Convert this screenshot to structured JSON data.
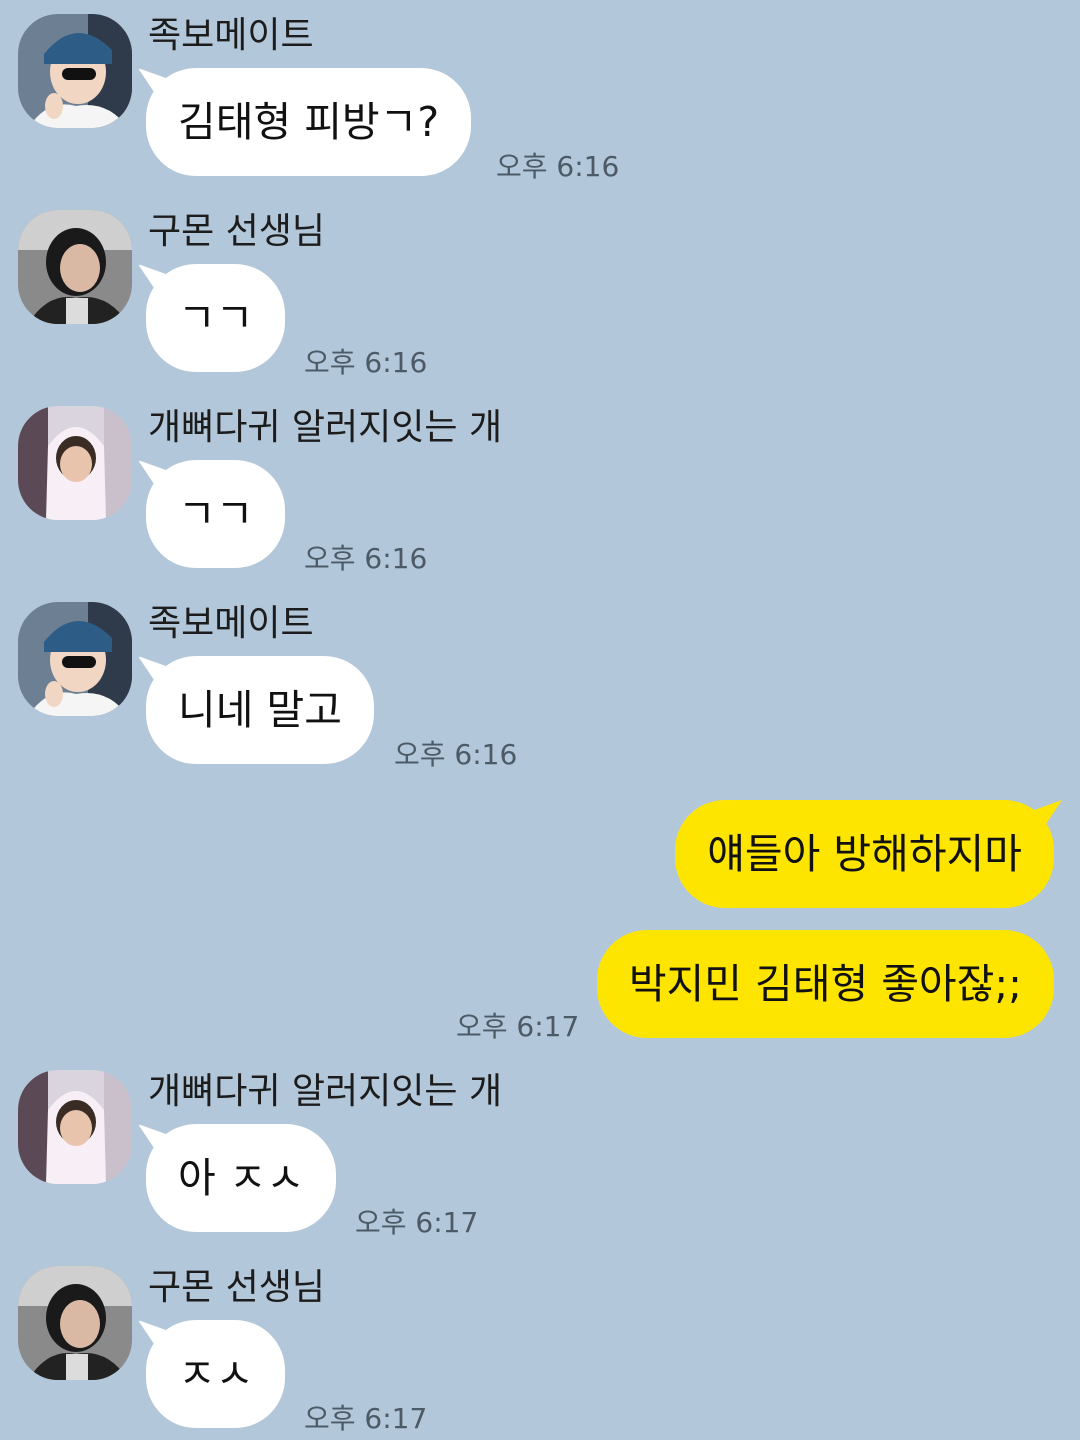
{
  "messages": [
    {
      "sender": "족보메이트",
      "text": "김태형 피방ㄱ?",
      "time": "오후 6:16"
    },
    {
      "sender": "구몬 선생님",
      "text": "ㄱㄱ",
      "time": "오후 6:16"
    },
    {
      "sender": "개뼈다귀 알러지잇는 개",
      "text": "ㄱㄱ",
      "time": "오후 6:16"
    },
    {
      "sender": "족보메이트",
      "text": "니네 말고",
      "time": "오후 6:16"
    },
    {
      "sender": "me",
      "text": "얘들아 방해하지마",
      "time": ""
    },
    {
      "sender": "me",
      "text": "박지민 김태형 좋아잖;;",
      "time": "오후 6:17"
    },
    {
      "sender": "개뼈다귀 알러지잇는 개",
      "text": "아 ㅈㅅ",
      "time": "오후 6:17"
    },
    {
      "sender": "구몬 선생님",
      "text": "ㅈㅅ",
      "time": "오후 6:17"
    }
  ],
  "colors": {
    "background": "#b2c7d9",
    "incoming_bubble": "#ffffff",
    "outgoing_bubble": "#fee500"
  }
}
